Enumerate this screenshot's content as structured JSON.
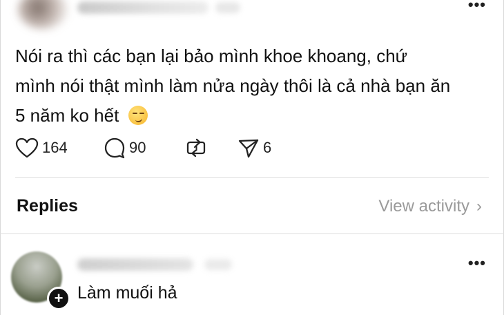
{
  "post": {
    "text_line1": "Nói ra thì các bạn lại bảo mình khoe khoang, chứ",
    "text_line2": "mình nói thật mình làm nửa ngày thôi là cả nhà bạn ăn",
    "text_line3": "5 năm ko hết",
    "emoji": "smirking-face-emoji",
    "likes": "164",
    "replies": "90",
    "shares": "6",
    "more_icon": "more-dots-icon"
  },
  "replies_section": {
    "title": "Replies",
    "view_activity": "View activity"
  },
  "reply": {
    "text": "Làm muối hả",
    "follow_icon": "plus-icon",
    "more_icon": "more-dots-icon"
  }
}
